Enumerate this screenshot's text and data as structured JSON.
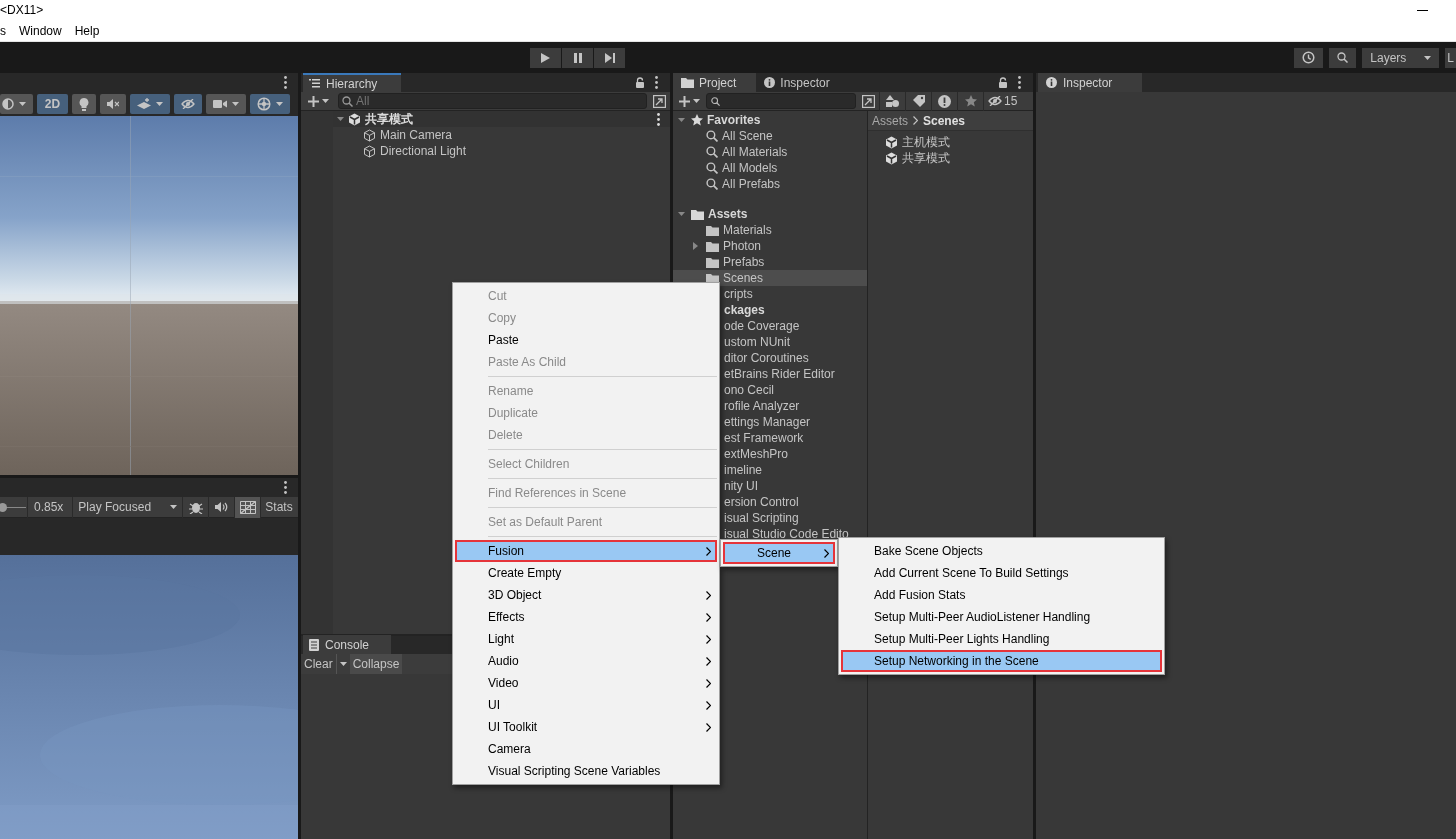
{
  "window": {
    "title": "<DX11>"
  },
  "menu_bar": [
    "s",
    "Window",
    "Help"
  ],
  "main_toolbar": {
    "layers": "Layers",
    "layout": "L"
  },
  "scene_toolbar": [
    {
      "kind": "shading",
      "on": false
    },
    {
      "kind": "dimension",
      "label": "2D",
      "on": true
    },
    {
      "kind": "lighting",
      "on": false
    },
    {
      "kind": "audio",
      "on": false
    },
    {
      "kind": "effects",
      "on": true
    },
    {
      "kind": "visibility",
      "on": true
    },
    {
      "kind": "camera",
      "on": false
    },
    {
      "kind": "gizmos",
      "on": true
    }
  ],
  "game_toolbar": {
    "scale": {
      "level": 0.08,
      "reading": "0.85x"
    },
    "play_mode": "Play Focused",
    "toggles": [
      {
        "kind": "debug",
        "on": false
      },
      {
        "kind": "audio",
        "on": false
      },
      {
        "kind": "gizmos",
        "on": true
      }
    ],
    "stats": "Stats"
  },
  "hierarchy": {
    "tab": "Hierarchy",
    "search_placeholder": "All",
    "tree": [
      {
        "label": "共享模式",
        "kind": "scene",
        "expanded": true,
        "selected": false,
        "children": [
          {
            "label": "Main Camera",
            "kind": "object",
            "selected": false
          },
          {
            "label": "Directional Light",
            "kind": "object",
            "selected": false
          }
        ]
      }
    ]
  },
  "console": {
    "tab": "Console",
    "buttons": [
      "Clear",
      "Collapse"
    ]
  },
  "project": {
    "tabs": [
      {
        "label": "Project",
        "selected": true
      },
      {
        "label": "Inspector",
        "selected": false
      }
    ],
    "hidden_count": "15",
    "tree": [
      {
        "label": "Favorites",
        "kind": "group",
        "expanded": true,
        "selected": false,
        "children": [
          {
            "label": "All Scene",
            "kind": "search",
            "selected": false
          },
          {
            "label": "All Materials",
            "kind": "search",
            "selected": false
          },
          {
            "label": "All Models",
            "kind": "search",
            "selected": false
          },
          {
            "label": "All Prefabs",
            "kind": "search",
            "selected": false
          }
        ]
      },
      {
        "label": "Assets",
        "kind": "group",
        "expanded": true,
        "selected": false,
        "children": [
          {
            "label": "Materials",
            "kind": "folder",
            "selected": false
          },
          {
            "label": "Photon",
            "kind": "folder",
            "expanded": false,
            "selected": false
          },
          {
            "label": "Prefabs",
            "kind": "folder",
            "selected": false
          },
          {
            "label": "Scenes",
            "kind": "folder",
            "selected": true
          },
          {
            "label": "cripts",
            "kind": "covered",
            "selected": false
          }
        ]
      },
      {
        "label": "ckages",
        "kind": "covered-group",
        "selected": false,
        "children": [
          {
            "label": "ode Coverage",
            "kind": "covered",
            "selected": false
          },
          {
            "label": "ustom NUnit",
            "kind": "covered",
            "selected": false
          },
          {
            "label": "ditor Coroutines",
            "kind": "covered",
            "selected": false
          },
          {
            "label": "etBrains Rider Editor",
            "kind": "covered",
            "selected": false
          },
          {
            "label": "ono Cecil",
            "kind": "covered",
            "selected": false
          },
          {
            "label": "rofile Analyzer",
            "kind": "covered",
            "selected": false
          },
          {
            "label": "ettings Manager",
            "kind": "covered",
            "selected": false
          },
          {
            "label": "est Framework",
            "kind": "covered",
            "selected": false
          },
          {
            "label": "extMeshPro",
            "kind": "covered",
            "selected": false
          },
          {
            "label": "imeline",
            "kind": "covered",
            "selected": false
          },
          {
            "label": "nity UI",
            "kind": "covered",
            "selected": false
          },
          {
            "label": "ersion Control",
            "kind": "covered",
            "selected": false
          },
          {
            "label": "isual Scripting",
            "kind": "covered",
            "selected": false
          },
          {
            "label": "isual Studio Code Edito",
            "kind": "covered",
            "selected": false
          }
        ]
      }
    ],
    "breadcrumb": [
      "Assets",
      "Scenes"
    ],
    "files": [
      {
        "label": "主机模式",
        "selected": false
      },
      {
        "label": "共享模式",
        "selected": false
      }
    ]
  },
  "inspector": {
    "tab": "Inspector"
  },
  "context_menu": {
    "items": [
      {
        "kind": "item",
        "label": "Cut",
        "disabled": true,
        "highlighted": false,
        "outlined": false
      },
      {
        "kind": "item",
        "label": "Copy",
        "disabled": true,
        "highlighted": false,
        "outlined": false
      },
      {
        "kind": "item",
        "label": "Paste",
        "disabled": false,
        "highlighted": false,
        "outlined": false
      },
      {
        "kind": "item",
        "label": "Paste As Child",
        "disabled": true,
        "highlighted": false,
        "outlined": false
      },
      {
        "kind": "separator"
      },
      {
        "kind": "item",
        "label": "Rename",
        "disabled": true,
        "highlighted": false,
        "outlined": false
      },
      {
        "kind": "item",
        "label": "Duplicate",
        "disabled": true,
        "highlighted": false,
        "outlined": false
      },
      {
        "kind": "item",
        "label": "Delete",
        "disabled": true,
        "highlighted": false,
        "outlined": false
      },
      {
        "kind": "separator"
      },
      {
        "kind": "item",
        "label": "Select Children",
        "disabled": true,
        "highlighted": false,
        "outlined": false
      },
      {
        "kind": "separator"
      },
      {
        "kind": "item",
        "label": "Find References in Scene",
        "disabled": true,
        "highlighted": false,
        "outlined": false
      },
      {
        "kind": "separator"
      },
      {
        "kind": "item",
        "label": "Set as Default Parent",
        "disabled": true,
        "highlighted": false,
        "outlined": false
      },
      {
        "kind": "separator"
      },
      {
        "kind": "submenu",
        "label": "Fusion",
        "disabled": false,
        "highlighted": true,
        "outlined": true
      },
      {
        "kind": "item",
        "label": "Create Empty",
        "disabled": false,
        "highlighted": false,
        "outlined": false
      },
      {
        "kind": "submenu",
        "label": "3D Object",
        "disabled": false,
        "highlighted": false,
        "outlined": false
      },
      {
        "kind": "submenu",
        "label": "Effects",
        "disabled": false,
        "highlighted": false,
        "outlined": false
      },
      {
        "kind": "submenu",
        "label": "Light",
        "disabled": false,
        "highlighted": false,
        "outlined": false
      },
      {
        "kind": "submenu",
        "label": "Audio",
        "disabled": false,
        "highlighted": false,
        "outlined": false
      },
      {
        "kind": "submenu",
        "label": "Video",
        "disabled": false,
        "highlighted": false,
        "outlined": false
      },
      {
        "kind": "submenu",
        "label": "UI",
        "disabled": false,
        "highlighted": false,
        "outlined": false
      },
      {
        "kind": "submenu",
        "label": "UI Toolkit",
        "disabled": false,
        "highlighted": false,
        "outlined": false
      },
      {
        "kind": "item",
        "label": "Camera",
        "disabled": false,
        "highlighted": false,
        "outlined": false
      },
      {
        "kind": "item",
        "label": "Visual Scripting Scene Variables",
        "disabled": false,
        "highlighted": false,
        "outlined": false
      }
    ]
  },
  "fusion_submenu": {
    "items": [
      {
        "kind": "submenu",
        "label": "Scene",
        "disabled": false,
        "highlighted": true,
        "outlined": true
      }
    ]
  },
  "scene_submenu": {
    "items": [
      {
        "kind": "item",
        "label": "Bake Scene Objects",
        "disabled": false,
        "highlighted": false,
        "outlined": false
      },
      {
        "kind": "item",
        "label": "Add Current Scene To Build Settings",
        "disabled": false,
        "highlighted": false,
        "outlined": false
      },
      {
        "kind": "item",
        "label": "Add Fusion Stats",
        "disabled": false,
        "highlighted": false,
        "outlined": false
      },
      {
        "kind": "item",
        "label": "Setup Multi-Peer AudioListener Handling",
        "disabled": false,
        "highlighted": false,
        "outlined": false
      },
      {
        "kind": "item",
        "label": "Setup Multi-Peer Lights Handling",
        "disabled": false,
        "highlighted": false,
        "outlined": false
      },
      {
        "kind": "item",
        "label": "Setup Networking in the Scene",
        "disabled": false,
        "highlighted": true,
        "outlined": true
      }
    ]
  }
}
